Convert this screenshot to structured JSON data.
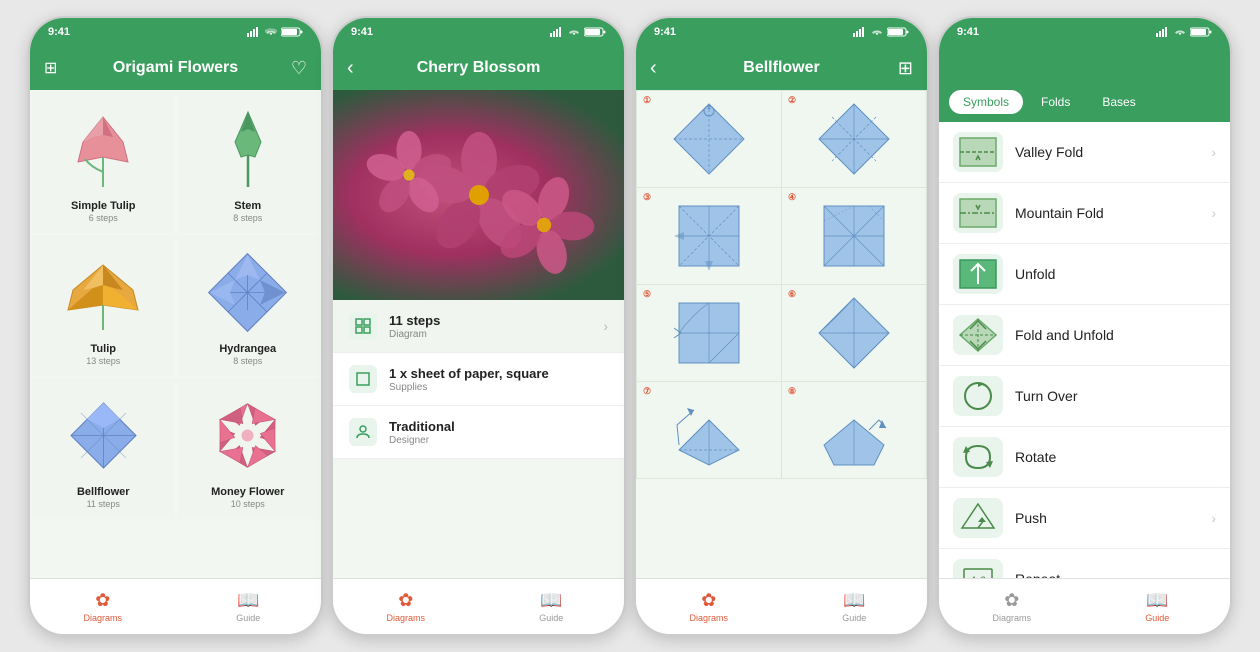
{
  "screens": [
    {
      "id": "screen1",
      "status_time": "9:41",
      "nav_title": "Origami Flowers",
      "flowers": [
        {
          "name": "Simple Tulip",
          "steps": "6 steps",
          "color": "#e8909a"
        },
        {
          "name": "Stem",
          "steps": "8 steps",
          "color": "#6ab87a"
        },
        {
          "name": "Tulip",
          "steps": "13 steps",
          "color": "#e8a840"
        },
        {
          "name": "Hydrangea",
          "steps": "8 steps",
          "color": "#8aace8"
        },
        {
          "name": "Bellflower",
          "steps": "11 steps",
          "color": "#8aace8"
        },
        {
          "name": "Money Flower",
          "steps": "10 steps",
          "color": "#e87090"
        }
      ],
      "tabs": [
        {
          "label": "Diagrams",
          "active": true
        },
        {
          "label": "Guide",
          "active": false
        }
      ]
    },
    {
      "id": "screen2",
      "status_time": "9:41",
      "nav_title": "Cherry Blossom",
      "info_rows": [
        {
          "icon": "grid",
          "title": "11 steps",
          "sub": "Diagram",
          "chevron": true
        },
        {
          "icon": "square",
          "title": "1 x sheet of paper, square",
          "sub": "Supplies",
          "chevron": false
        },
        {
          "icon": "person",
          "title": "Traditional",
          "sub": "Designer",
          "chevron": false
        }
      ],
      "tabs": [
        {
          "label": "Diagrams",
          "active": true
        },
        {
          "label": "Guide",
          "active": false
        }
      ]
    },
    {
      "id": "screen3",
      "status_time": "9:41",
      "nav_title": "Bellflower",
      "steps": [
        1,
        2,
        3,
        4,
        5,
        6,
        7,
        8
      ],
      "tabs": [
        {
          "label": "Diagrams",
          "active": true
        },
        {
          "label": "Guide",
          "active": false
        }
      ]
    },
    {
      "id": "screen4",
      "status_time": "9:41",
      "nav_title": "",
      "guide_tabs": [
        {
          "label": "Symbols",
          "active": true
        },
        {
          "label": "Folds",
          "active": false
        },
        {
          "label": "Bases",
          "active": false
        }
      ],
      "symbols": [
        {
          "label": "Valley Fold",
          "has_chevron": true
        },
        {
          "label": "Mountain Fold",
          "has_chevron": true
        },
        {
          "label": "Unfold",
          "has_chevron": false
        },
        {
          "label": "Fold and Unfold",
          "has_chevron": false
        },
        {
          "label": "Turn Over",
          "has_chevron": false
        },
        {
          "label": "Rotate",
          "has_chevron": false
        },
        {
          "label": "Push",
          "has_chevron": true
        },
        {
          "label": "Repeat",
          "has_chevron": false
        }
      ],
      "tabs": [
        {
          "label": "Diagrams",
          "active": false
        },
        {
          "label": "Guide",
          "active": true
        }
      ]
    }
  ]
}
